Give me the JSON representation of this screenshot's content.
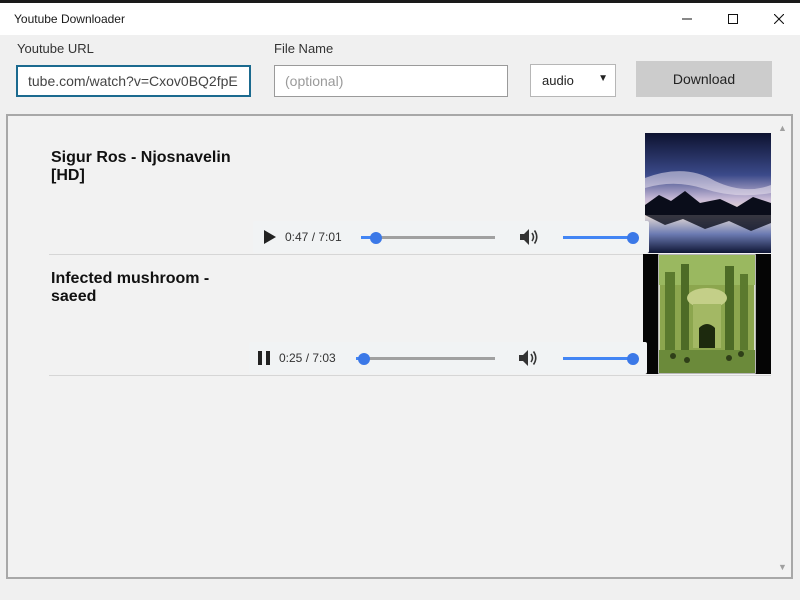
{
  "window": {
    "title": "Youtube Downloader"
  },
  "form": {
    "url_label": "Youtube URL",
    "url_value": "tube.com/watch?v=Cxov0BQ2fpE",
    "filename_label": "File Name",
    "filename_placeholder": "(optional)",
    "format_selected": "audio",
    "download_label": "Download"
  },
  "items": [
    {
      "title": "Sigur Ros - Njosnavelin [HD]",
      "current_time": "0:47",
      "duration": "7:01",
      "state": "paused",
      "progress": 0.11,
      "volume": 1.0,
      "thumbnail": "sunset-lake"
    },
    {
      "title": "Infected mushroom - saeed",
      "current_time": "0:25",
      "duration": "7:03",
      "state": "playing",
      "progress": 0.06,
      "volume": 1.0,
      "thumbnail": "forest-album-art"
    }
  ],
  "colors": {
    "accent": "#4285f4",
    "input_focus": "#1b6a8f",
    "button_bg": "#cccccc"
  }
}
